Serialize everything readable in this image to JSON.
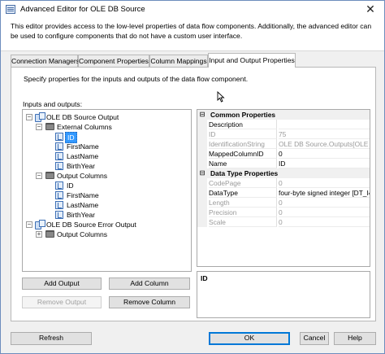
{
  "window": {
    "title": "Advanced Editor for OLE DB Source",
    "close_glyph": "✕",
    "header_text": "This editor provides access to the low-level properties of data flow components. Additionally, the advanced editor can be used to configure components that do not have a custom user interface."
  },
  "tabs": [
    {
      "label": "Connection Managers",
      "active": false
    },
    {
      "label": "Component Properties",
      "active": false
    },
    {
      "label": "Column Mappings",
      "active": false
    },
    {
      "label": "Input and Output Properties",
      "active": true
    }
  ],
  "panel": {
    "description": "Specify properties for the inputs and outputs of the data flow component.",
    "inputs_outputs_label": "Inputs and outputs:"
  },
  "tree": {
    "source_output": "OLE DB Source Output",
    "external_columns": "External Columns",
    "external_items": [
      "ID",
      "FirstName",
      "LastName",
      "BirthYear"
    ],
    "output_columns": "Output Columns",
    "output_items": [
      "ID",
      "FirstName",
      "LastName",
      "BirthYear"
    ],
    "error_output": "OLE DB Source Error Output",
    "error_output_columns": "Output Columns",
    "selected_item": "ID",
    "icons": {
      "output": "data-source-icon",
      "folder": "folder-icon",
      "column": "column-icon"
    }
  },
  "buttons": {
    "add_output": "Add Output",
    "add_column": "Add Column",
    "remove_output": "Remove Output",
    "remove_column": "Remove Column",
    "refresh": "Refresh",
    "ok": "OK",
    "cancel": "Cancel",
    "help": "Help"
  },
  "properties": {
    "common": {
      "category": "Common Properties",
      "rows": [
        {
          "name": "Description",
          "value": "",
          "readonly": false
        },
        {
          "name": "ID",
          "value": "75",
          "readonly": true
        },
        {
          "name": "IdentificationString",
          "value": "OLE DB Source.Outputs[OLE DB",
          "readonly": true
        },
        {
          "name": "MappedColumnID",
          "value": "0",
          "readonly": false
        },
        {
          "name": "Name",
          "value": "ID",
          "readonly": false
        }
      ]
    },
    "data_type": {
      "category": "Data Type Properties",
      "rows": [
        {
          "name": "CodePage",
          "value": "0",
          "readonly": true
        },
        {
          "name": "DataType",
          "value": "four-byte signed integer [DT_I4",
          "readonly": false
        },
        {
          "name": "Length",
          "value": "0",
          "readonly": true
        },
        {
          "name": "Precision",
          "value": "0",
          "readonly": true
        },
        {
          "name": "Scale",
          "value": "0",
          "readonly": true
        }
      ]
    },
    "toggle_glyph": "⊟"
  },
  "info_panel": {
    "title": "ID"
  },
  "colors": {
    "selection": "#3399ff",
    "accent_border": "#0078d7"
  }
}
